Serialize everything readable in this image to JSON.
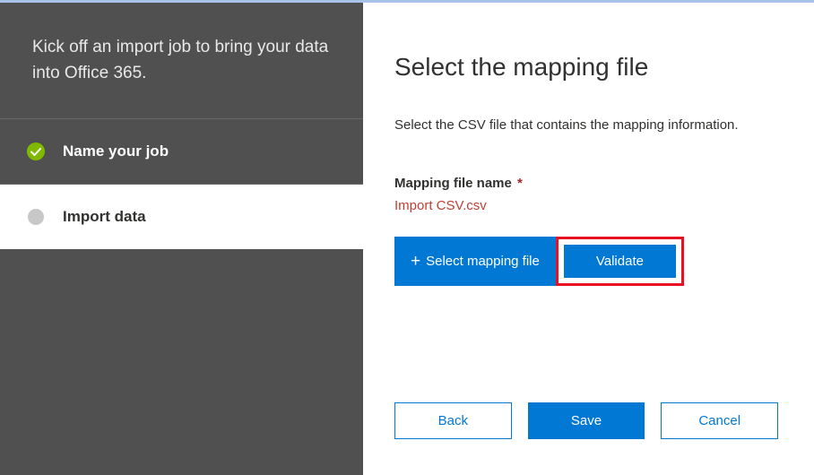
{
  "sidebar": {
    "header": "Kick off an import job to bring your data into Office 365.",
    "steps": [
      {
        "label": "Name your job",
        "state": "completed"
      },
      {
        "label": "Import data",
        "state": "current"
      }
    ]
  },
  "main": {
    "title": "Select the mapping file",
    "description": "Select the CSV file that contains the mapping information.",
    "field_label": "Mapping file name",
    "required_mark": "*",
    "file_name": "Import CSV.csv",
    "select_file_label": "Select mapping file",
    "validate_label": "Validate"
  },
  "footer": {
    "back": "Back",
    "save": "Save",
    "cancel": "Cancel"
  }
}
